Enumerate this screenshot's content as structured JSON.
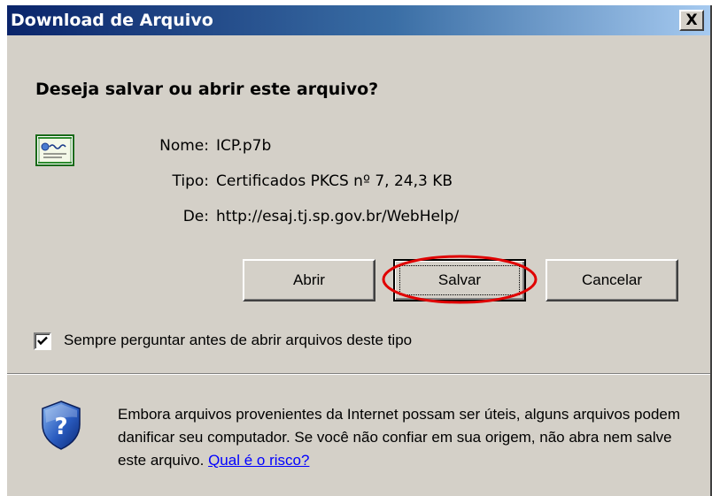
{
  "window": {
    "title": "Download de Arquivo",
    "close_label": "X"
  },
  "question": "Deseja salvar ou abrir este arquivo?",
  "file": {
    "icon": "certificate-icon",
    "name_label": "Nome:",
    "name_value": "ICP.p7b",
    "type_label": "Tipo:",
    "type_value": "Certificados PKCS nº 7, 24,3 KB",
    "from_label": "De:",
    "from_value": "http://esaj.tj.sp.gov.br/WebHelp/"
  },
  "buttons": {
    "open_label": "Abrir",
    "save_label": "Salvar",
    "cancel_label": "Cancelar"
  },
  "always_ask": {
    "checked": true,
    "label": "Sempre perguntar antes de abrir arquivos deste tipo"
  },
  "warning": {
    "icon": "shield-question-icon",
    "text": "Embora arquivos provenientes da Internet possam ser úteis, alguns arquivos podem danificar seu computador. Se você não confiar em sua origem, não abra nem salve este arquivo.",
    "link_label": "Qual é o risco?"
  },
  "colors": {
    "title_gradient_start": "#0a246a",
    "title_gradient_end": "#a6caf0",
    "dialog_bg": "#d4d0c8",
    "highlight_ellipse": "#e00000",
    "link": "#0000ff"
  }
}
